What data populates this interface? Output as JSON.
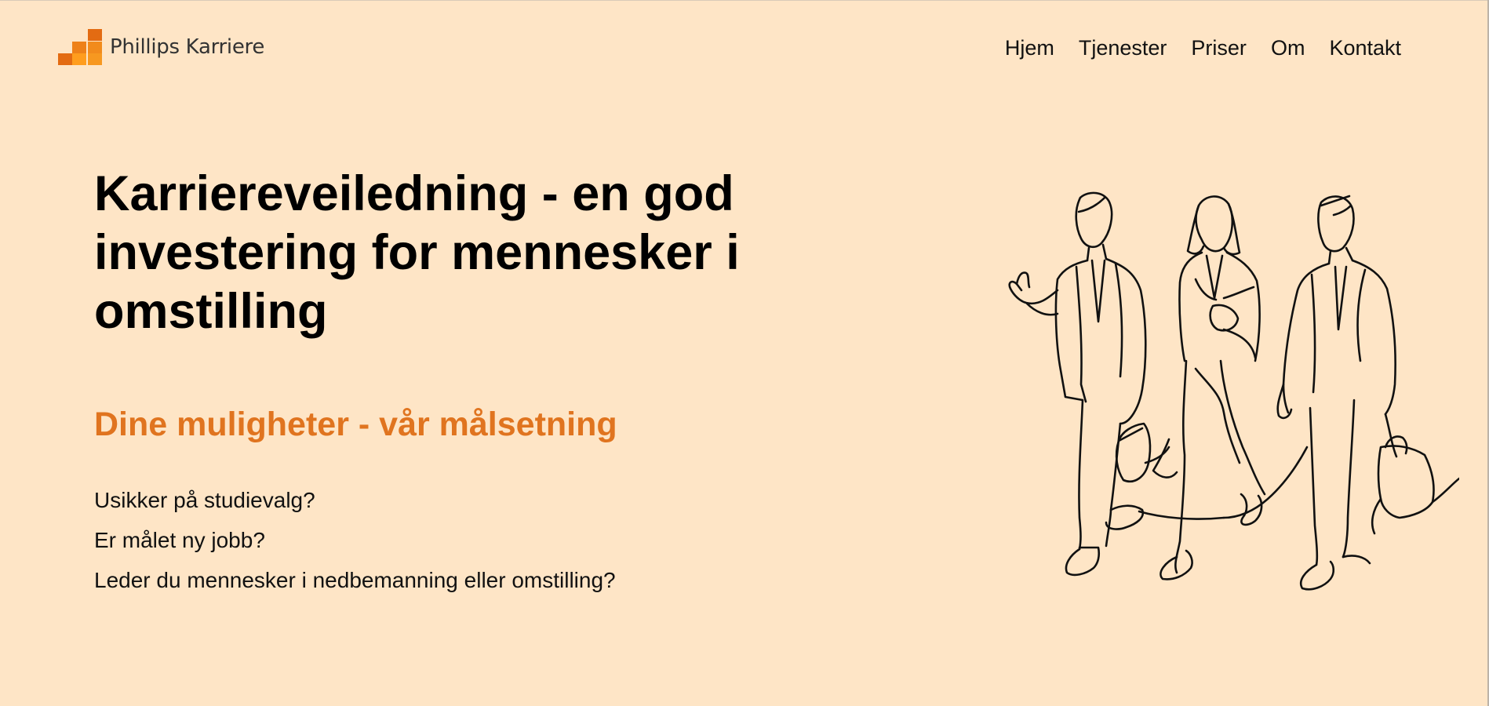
{
  "header": {
    "logo_text": "Phillips Karriere",
    "logo_colors": [
      "#e36b12",
      "#f28b1c",
      "#ff9d1e",
      "#ee8119"
    ],
    "nav": [
      {
        "label": "Hjem"
      },
      {
        "label": "Tjenester"
      },
      {
        "label": "Priser"
      },
      {
        "label": "Om"
      },
      {
        "label": "Kontakt"
      }
    ]
  },
  "hero": {
    "title": "Karriereveiledning - en god investering for mennesker i omstilling",
    "subtitle": "Dine muligheter - vår målsetning",
    "questions": [
      "Usikker på studievalg?",
      "Er målet ny jobb?",
      "Leder du mennesker i nedbemanning eller omstilling?"
    ]
  },
  "illustration": {
    "icon": "people-walking-line-art-icon"
  },
  "colors": {
    "background": "#fee5c6",
    "accent": "#e0741f",
    "text": "#111111"
  }
}
